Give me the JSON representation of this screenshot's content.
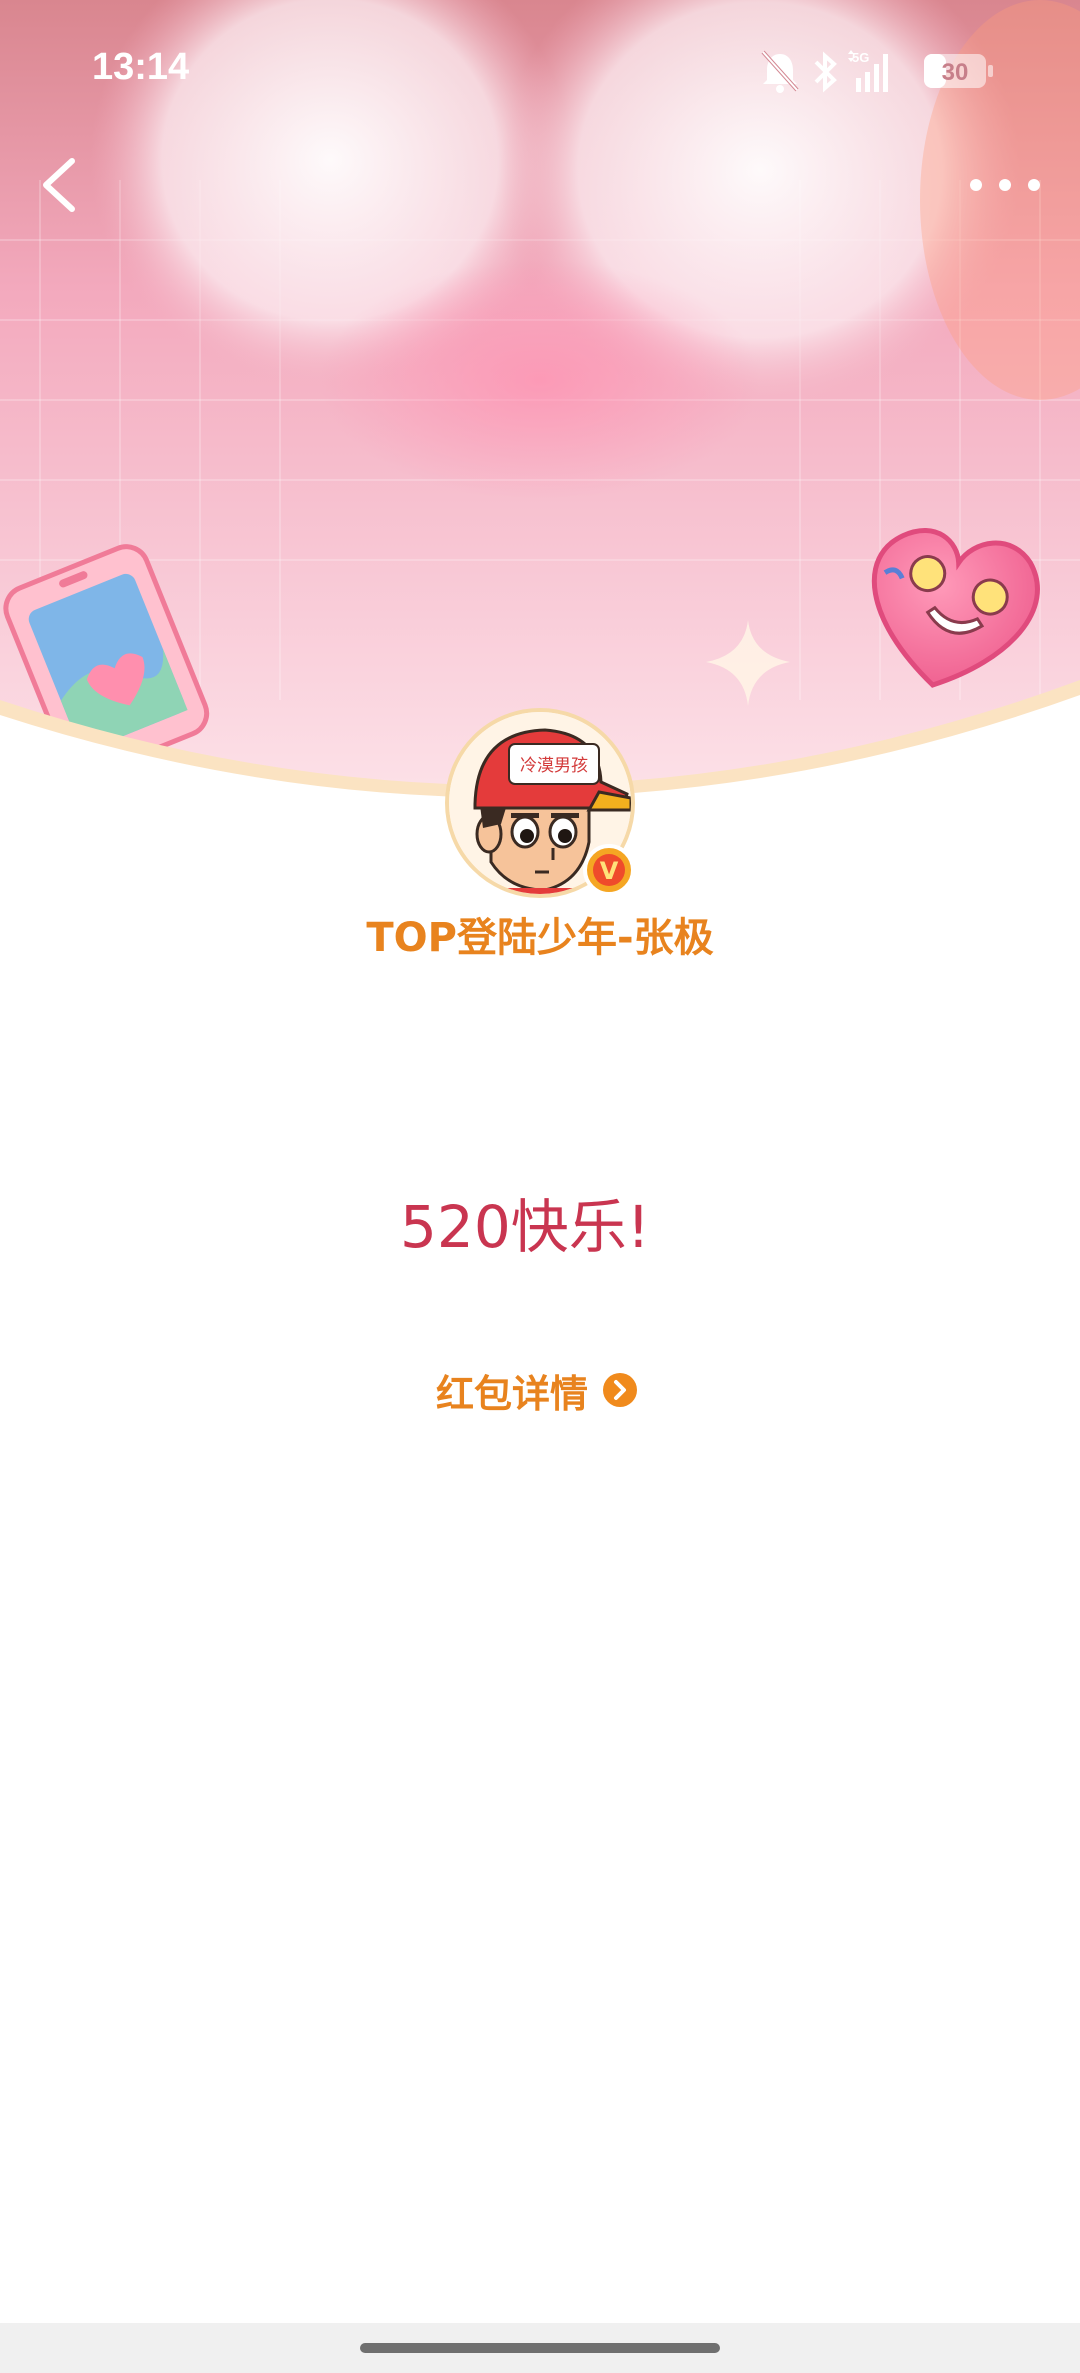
{
  "status_bar": {
    "time": "13:14",
    "network": "5G",
    "battery": "30",
    "icons": [
      "bell-muted-icon",
      "bluetooth-icon",
      "signal-icon",
      "battery-icon"
    ]
  },
  "nav": {
    "back_icon": "chevron-left-icon",
    "more_icon": "more-dots-icon"
  },
  "profile": {
    "avatar_caption": "冷漠男孩",
    "verified_mark": "V",
    "username": "TOP登陆少年-张极"
  },
  "message": {
    "greeting": "520快乐!"
  },
  "detail": {
    "label": "红包详情",
    "icon": "chevron-right-circle-icon"
  },
  "colors": {
    "accent_orange": "#e8831e",
    "greeting_red": "#c93550",
    "banner_pink": "#f7b6c8"
  }
}
